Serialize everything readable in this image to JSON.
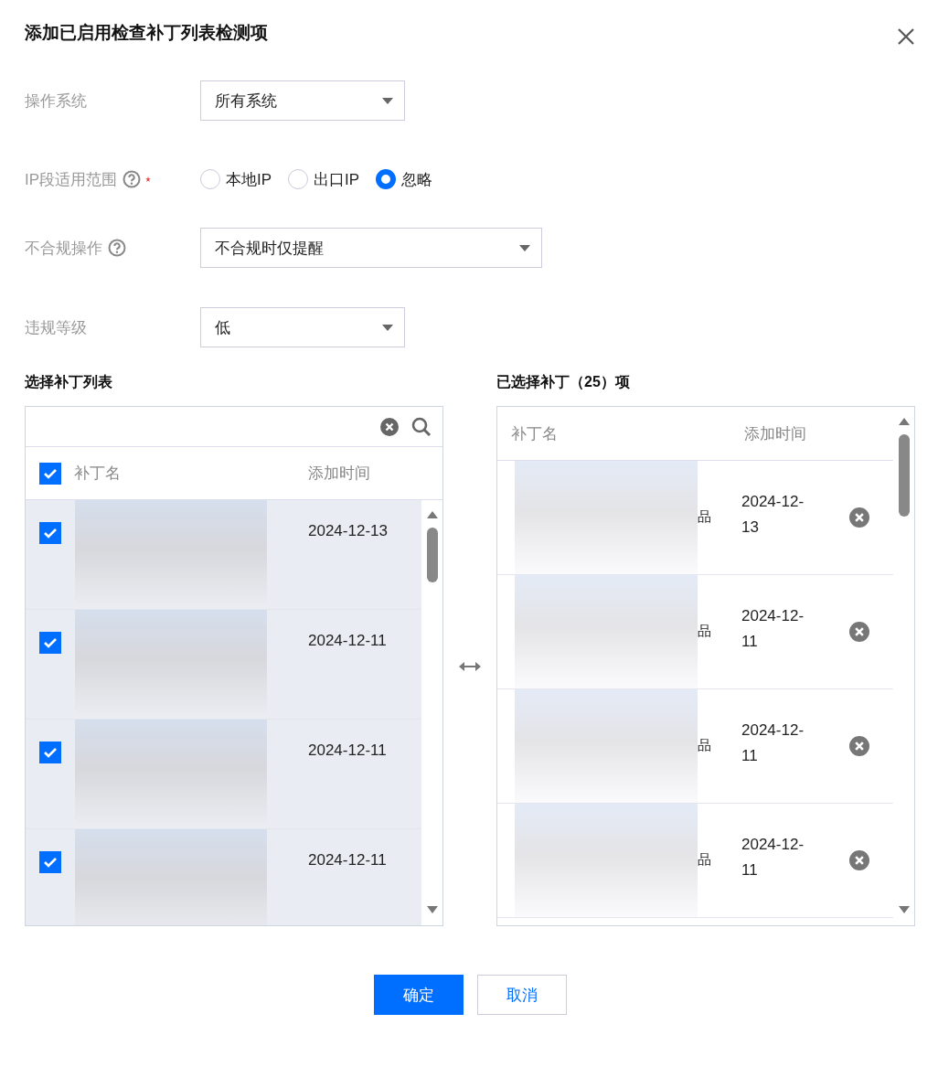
{
  "dialog": {
    "title": "添加已启用检查补丁列表检测项"
  },
  "form": [
    {
      "kind": "select",
      "label": "操作系统",
      "value": "所有系统",
      "wide": false
    },
    {
      "kind": "radio",
      "label": "IP段适用范围",
      "help": true,
      "required": true,
      "options": [
        {
          "label": "本地IP",
          "selected": false
        },
        {
          "label": "出口IP",
          "selected": false
        },
        {
          "label": "忽略",
          "selected": true
        }
      ]
    },
    {
      "kind": "select",
      "label": "不合规操作",
      "help": true,
      "value": "不合规时仅提醒",
      "wide": true
    },
    {
      "kind": "select",
      "label": "违规等级",
      "value": "低",
      "wide": false
    }
  ],
  "source": {
    "title": "选择补丁列表",
    "all_checked": true,
    "columns": [
      "补丁名",
      "添加时间"
    ],
    "rows": [
      {
        "checked": true,
        "date": "2024-12-13"
      },
      {
        "checked": true,
        "date": "2024-12-11"
      },
      {
        "checked": true,
        "date": "2024-12-11"
      },
      {
        "checked": true,
        "date": "2024-12-11"
      }
    ]
  },
  "target": {
    "title": "已选择补丁（25）项",
    "columns": [
      "补丁名",
      "添加时间"
    ],
    "rows": [
      {
        "name_tail": "品",
        "date": "2024-12-13"
      },
      {
        "name_tail": "品",
        "date": "2024-12-11"
      },
      {
        "name_tail": "品",
        "date": "2024-12-11"
      },
      {
        "name_tail": "品",
        "date": "2024-12-11"
      }
    ]
  },
  "buttons": [
    {
      "kind": "primary",
      "label": "确定"
    },
    {
      "kind": "secondary",
      "label": "取消"
    }
  ]
}
